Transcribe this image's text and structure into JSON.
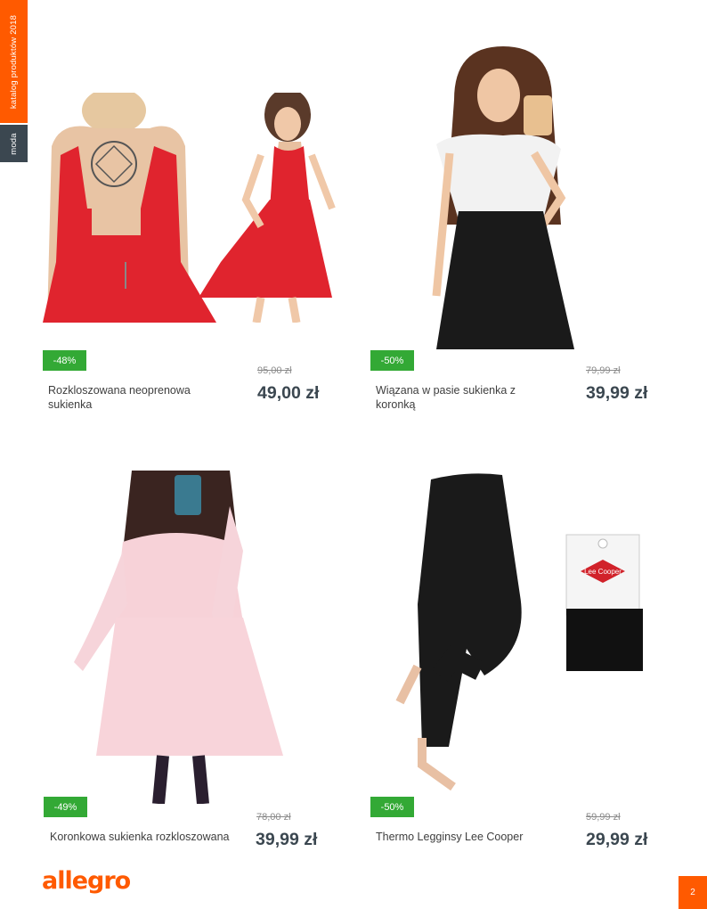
{
  "sidebar": {
    "catalog_label": "katalog produktów 2018",
    "section_label": "moda"
  },
  "products": [
    {
      "name": "Rozkloszowana neoprenowa sukienka",
      "discount": "-48%",
      "old_price": "95,00 zł",
      "price": "49,00 zł",
      "image": "red-dress-photo"
    },
    {
      "name": "Wiązana w pasie sukienka z koronką",
      "discount": "-50%",
      "old_price": "79,99 zł",
      "price": "39,99 zł",
      "image": "white-black-dress-photo"
    },
    {
      "name": "Koronkowa sukienka rozkloszowana",
      "discount": "-49%",
      "old_price": "78,00 zł",
      "price": "39,99 zł",
      "image": "pink-lace-dress-photo"
    },
    {
      "name": "Thermo Legginsy Lee Cooper",
      "discount": "-50%",
      "old_price": "59,99 zł",
      "price": "29,99 zł",
      "image": "black-leggings-photo"
    }
  ],
  "brand": {
    "logo_text": "allegro",
    "packaging_text": "Lee Cooper"
  },
  "page_number": "2",
  "colors": {
    "accent": "#ff5a00",
    "dark": "#3b4750",
    "badge": "#33a935"
  }
}
